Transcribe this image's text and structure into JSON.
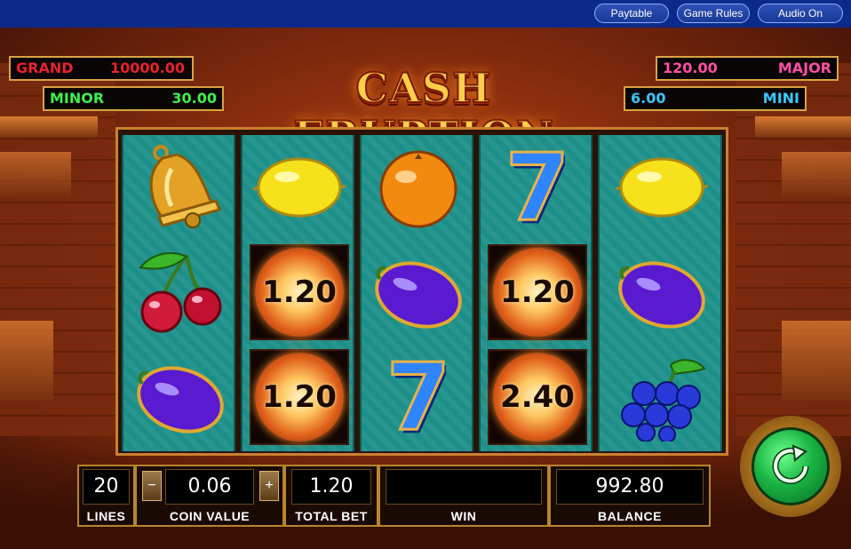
{
  "topbar": {
    "paytable": "Paytable",
    "game_rules": "Game Rules",
    "audio": "Audio On"
  },
  "jackpots": {
    "grand": {
      "label": "GRAND",
      "value": "10000.00"
    },
    "major": {
      "label": "MAJOR",
      "value": "120.00"
    },
    "minor": {
      "label": "MINOR",
      "value": "30.00"
    },
    "mini": {
      "label": "MINI",
      "value": "6.00"
    }
  },
  "game_title": "CASH ERUPTION",
  "reels": [
    [
      "bell",
      "cherries",
      "plum"
    ],
    [
      "lemon",
      "fireball",
      "fireball"
    ],
    [
      "orange",
      "plum",
      "seven"
    ],
    [
      "seven",
      "fireball",
      "fireball"
    ],
    [
      "lemon",
      "plum",
      "grapes"
    ]
  ],
  "fireball_values": {
    "r2_row2": "1.20",
    "r2_row3": "1.20",
    "r4_row2": "1.20",
    "r4_row3": "2.40"
  },
  "seven_glyph": "7",
  "hud": {
    "lines": {
      "value": "20",
      "label": "LINES"
    },
    "coin_value": {
      "value": "0.06",
      "label": "COIN VALUE",
      "minus": "−",
      "plus": "+"
    },
    "total_bet": {
      "value": "1.20",
      "label": "TOTAL BET"
    },
    "win": {
      "value": "",
      "label": "WIN"
    },
    "balance": {
      "value": "992.80",
      "label": "BALANCE"
    }
  },
  "colors": {
    "jackpot_red": "#e8222a",
    "jackpot_pink": "#ff4fa3",
    "jackpot_green": "#3cf04a",
    "jackpot_cyan": "#36c8ff",
    "reel_teal": "#1d8f89",
    "gold_frame": "#c9812e",
    "topbar_blue": "#0c2a8a"
  },
  "icons": {
    "spin": "refresh-arrow-icon",
    "minus": "minus-icon",
    "plus": "plus-icon"
  }
}
